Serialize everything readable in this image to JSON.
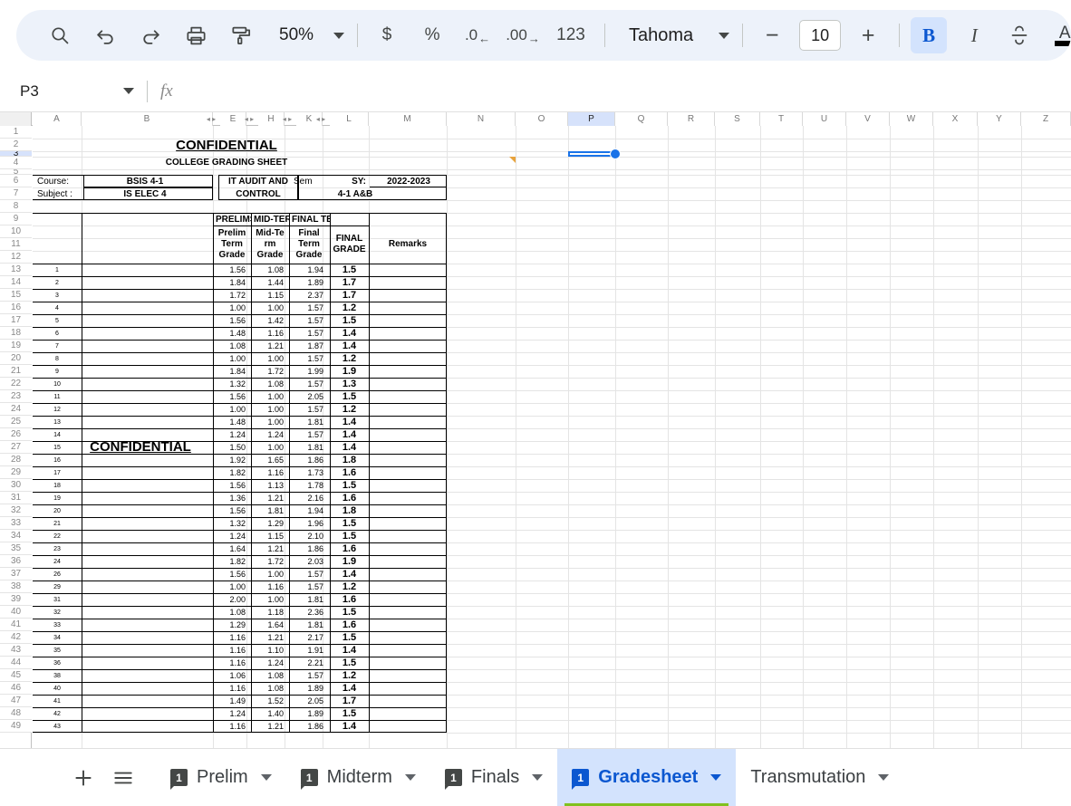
{
  "toolbar": {
    "search_label": "search-icon",
    "undo_label": "undo-icon",
    "redo_label": "redo-icon",
    "print_label": "print-icon",
    "paint_format_label": "paint-format-icon",
    "zoom_value": "50%",
    "currency_label": "$",
    "percent_label": "%",
    "decrease_decimal_label": ".0",
    "increase_decimal_label": ".00",
    "number_format_label": "123",
    "font_name": "Tahoma",
    "decrease_font_label": "−",
    "font_size": "10",
    "increase_font_label": "+",
    "bold_label": "B",
    "italic_label": "I",
    "strikethrough_label": "strikethrough-icon",
    "text_color_label": "A",
    "fill_color_label": "fill-color-icon"
  },
  "formula_bar": {
    "name_box_value": "P3",
    "fx_label": "fx",
    "formula_value": ""
  },
  "grid": {
    "columns": [
      "A",
      "B",
      "E",
      "H",
      "K",
      "L",
      "M",
      "N",
      "O",
      "P",
      "Q",
      "R",
      "S",
      "T",
      "U",
      "V",
      "W",
      "X",
      "Y",
      "Z"
    ],
    "selected_column": "P",
    "hidden_column_marker": "◂ ▸",
    "rows": [
      "1",
      "2",
      "3",
      "4",
      "5",
      "6",
      "7",
      "8",
      "9",
      "10",
      "11",
      "12",
      "13",
      "14",
      "15",
      "16",
      "17",
      "18",
      "19",
      "20",
      "21",
      "22",
      "23",
      "24",
      "25",
      "26",
      "27",
      "28",
      "29",
      "30",
      "31",
      "32",
      "33",
      "34",
      "35",
      "36",
      "37",
      "38",
      "39",
      "40",
      "41",
      "42",
      "43",
      "44",
      "45",
      "46",
      "47",
      "48",
      "49"
    ],
    "selected_cell": "P3"
  },
  "sheet": {
    "title_confidential": "CONFIDENTIAL",
    "subtitle": "COLLEGE GRADING SHEET",
    "watermark": "CONFIDENTIAL",
    "info": {
      "course_label": "Course:",
      "course_value": "BSIS 4-1",
      "subject_label": "Subject :",
      "subject_value": "IS ELEC 4",
      "description_line1": "IT AUDIT AND",
      "description_line2": "CONTROL",
      "sem_label": "Sem",
      "sem_value": "4-1 A&B",
      "sy_label": "SY:",
      "sy_value": "2022-2023"
    },
    "group_headers": [
      "PRELIMS",
      "MID-TERM",
      "FINAL TERM"
    ],
    "column_headers": {
      "prelim": [
        "Prelim",
        "Term",
        "Grade"
      ],
      "midterm": [
        "Mid-Te",
        "rm",
        "Grade"
      ],
      "finalterm": [
        "Final",
        "Term",
        "Grade"
      ],
      "final_grade": [
        "FINAL",
        "GRADE"
      ],
      "remarks": "Remarks"
    },
    "students": [
      {
        "no": "1",
        "prelim": "1.56",
        "midterm": "1.08",
        "finalterm": "1.94",
        "final": "1.5",
        "remarks": ""
      },
      {
        "no": "2",
        "prelim": "1.84",
        "midterm": "1.44",
        "finalterm": "1.89",
        "final": "1.7",
        "remarks": ""
      },
      {
        "no": "3",
        "prelim": "1.72",
        "midterm": "1.15",
        "finalterm": "2.37",
        "final": "1.7",
        "remarks": ""
      },
      {
        "no": "4",
        "prelim": "1.00",
        "midterm": "1.00",
        "finalterm": "1.57",
        "final": "1.2",
        "remarks": ""
      },
      {
        "no": "5",
        "prelim": "1.56",
        "midterm": "1.42",
        "finalterm": "1.57",
        "final": "1.5",
        "remarks": ""
      },
      {
        "no": "6",
        "prelim": "1.48",
        "midterm": "1.16",
        "finalterm": "1.57",
        "final": "1.4",
        "remarks": ""
      },
      {
        "no": "7",
        "prelim": "1.08",
        "midterm": "1.21",
        "finalterm": "1.87",
        "final": "1.4",
        "remarks": ""
      },
      {
        "no": "8",
        "prelim": "1.00",
        "midterm": "1.00",
        "finalterm": "1.57",
        "final": "1.2",
        "remarks": ""
      },
      {
        "no": "9",
        "prelim": "1.84",
        "midterm": "1.72",
        "finalterm": "1.99",
        "final": "1.9",
        "remarks": ""
      },
      {
        "no": "10",
        "prelim": "1.32",
        "midterm": "1.08",
        "finalterm": "1.57",
        "final": "1.3",
        "remarks": ""
      },
      {
        "no": "11",
        "prelim": "1.56",
        "midterm": "1.00",
        "finalterm": "2.05",
        "final": "1.5",
        "remarks": ""
      },
      {
        "no": "12",
        "prelim": "1.00",
        "midterm": "1.00",
        "finalterm": "1.57",
        "final": "1.2",
        "remarks": ""
      },
      {
        "no": "13",
        "prelim": "1.48",
        "midterm": "1.00",
        "finalterm": "1.81",
        "final": "1.4",
        "remarks": ""
      },
      {
        "no": "14",
        "prelim": "1.24",
        "midterm": "1.24",
        "finalterm": "1.57",
        "final": "1.4",
        "remarks": ""
      },
      {
        "no": "15",
        "prelim": "1.50",
        "midterm": "1.00",
        "finalterm": "1.81",
        "final": "1.4",
        "remarks": ""
      },
      {
        "no": "16",
        "prelim": "1.92",
        "midterm": "1.65",
        "finalterm": "1.86",
        "final": "1.8",
        "remarks": ""
      },
      {
        "no": "17",
        "prelim": "1.82",
        "midterm": "1.16",
        "finalterm": "1.73",
        "final": "1.6",
        "remarks": ""
      },
      {
        "no": "18",
        "prelim": "1.56",
        "midterm": "1.13",
        "finalterm": "1.78",
        "final": "1.5",
        "remarks": ""
      },
      {
        "no": "19",
        "prelim": "1.36",
        "midterm": "1.21",
        "finalterm": "2.16",
        "final": "1.6",
        "remarks": ""
      },
      {
        "no": "20",
        "prelim": "1.56",
        "midterm": "1.81",
        "finalterm": "1.94",
        "final": "1.8",
        "remarks": ""
      },
      {
        "no": "21",
        "prelim": "1.32",
        "midterm": "1.29",
        "finalterm": "1.96",
        "final": "1.5",
        "remarks": ""
      },
      {
        "no": "22",
        "prelim": "1.24",
        "midterm": "1.15",
        "finalterm": "2.10",
        "final": "1.5",
        "remarks": ""
      },
      {
        "no": "23",
        "prelim": "1.64",
        "midterm": "1.21",
        "finalterm": "1.86",
        "final": "1.6",
        "remarks": ""
      },
      {
        "no": "24",
        "prelim": "1.82",
        "midterm": "1.72",
        "finalterm": "2.03",
        "final": "1.9",
        "remarks": ""
      },
      {
        "no": "26",
        "prelim": "1.56",
        "midterm": "1.00",
        "finalterm": "1.57",
        "final": "1.4",
        "remarks": ""
      },
      {
        "no": "29",
        "prelim": "1.00",
        "midterm": "1.16",
        "finalterm": "1.57",
        "final": "1.2",
        "remarks": ""
      },
      {
        "no": "31",
        "prelim": "2.00",
        "midterm": "1.00",
        "finalterm": "1.81",
        "final": "1.6",
        "remarks": ""
      },
      {
        "no": "32",
        "prelim": "1.08",
        "midterm": "1.18",
        "finalterm": "2.36",
        "final": "1.5",
        "remarks": ""
      },
      {
        "no": "33",
        "prelim": "1.29",
        "midterm": "1.64",
        "finalterm": "1.81",
        "final": "1.6",
        "remarks": ""
      },
      {
        "no": "34",
        "prelim": "1.16",
        "midterm": "1.21",
        "finalterm": "2.17",
        "final": "1.5",
        "remarks": ""
      },
      {
        "no": "35",
        "prelim": "1.16",
        "midterm": "1.10",
        "finalterm": "1.91",
        "final": "1.4",
        "remarks": ""
      },
      {
        "no": "36",
        "prelim": "1.16",
        "midterm": "1.24",
        "finalterm": "2.21",
        "final": "1.5",
        "remarks": ""
      },
      {
        "no": "38",
        "prelim": "1.06",
        "midterm": "1.08",
        "finalterm": "1.57",
        "final": "1.2",
        "remarks": ""
      },
      {
        "no": "40",
        "prelim": "1.16",
        "midterm": "1.08",
        "finalterm": "1.89",
        "final": "1.4",
        "remarks": ""
      },
      {
        "no": "41",
        "prelim": "1.49",
        "midterm": "1.52",
        "finalterm": "2.05",
        "final": "1.7",
        "remarks": ""
      },
      {
        "no": "42",
        "prelim": "1.24",
        "midterm": "1.40",
        "finalterm": "1.89",
        "final": "1.5",
        "remarks": ""
      },
      {
        "no": "43",
        "prelim": "1.16",
        "midterm": "1.21",
        "finalterm": "1.86",
        "final": "1.4",
        "remarks": ""
      }
    ]
  },
  "tabbar": {
    "add_sheet_label": "add-sheet-icon",
    "all_sheets_label": "all-sheets-icon",
    "tabs": [
      {
        "name": "Prelim",
        "badge": "1",
        "active": false
      },
      {
        "name": "Midterm",
        "badge": "1",
        "active": false
      },
      {
        "name": "Finals",
        "badge": "1",
        "active": false
      },
      {
        "name": "Gradesheet",
        "badge": "1",
        "active": true
      },
      {
        "name": "Transmutation",
        "badge": "",
        "active": false
      }
    ]
  },
  "colors": {
    "accent": "#0b57d0",
    "toolbar_bg": "#edf2fa",
    "active_tab_bg": "#d3e3fd",
    "active_tab_underline": "#80c11e",
    "selection": "#1a73e8"
  }
}
